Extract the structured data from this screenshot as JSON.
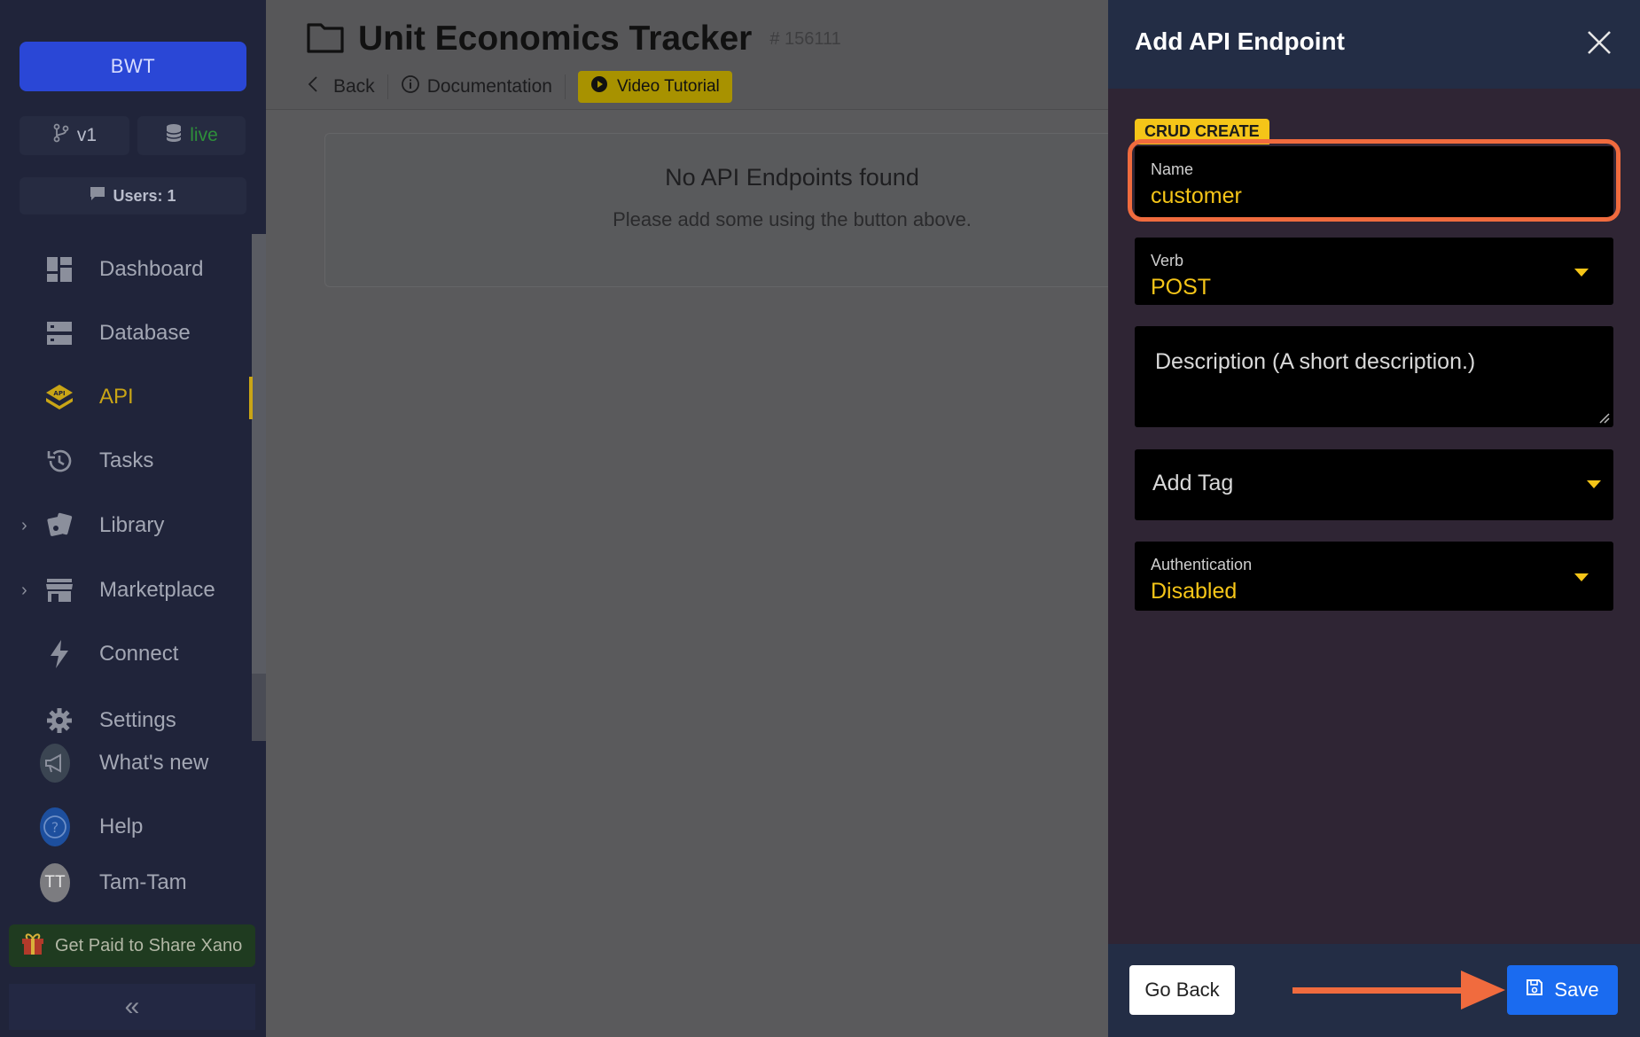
{
  "sidebar": {
    "workspace": "BWT",
    "branch": "v1",
    "datasource": "live",
    "users": "Users: 1",
    "items": [
      {
        "label": "Dashboard"
      },
      {
        "label": "Database"
      },
      {
        "label": "API"
      },
      {
        "label": "Tasks"
      },
      {
        "label": "Library"
      },
      {
        "label": "Marketplace"
      },
      {
        "label": "Connect"
      },
      {
        "label": "Settings"
      },
      {
        "label": "What's new"
      },
      {
        "label": "Help"
      }
    ],
    "user": {
      "initials": "TT",
      "name": "Tam-Tam"
    },
    "promo": "Get Paid to Share Xano",
    "collapse_icon": "«"
  },
  "page": {
    "title": "Unit Economics Tracker",
    "id": "# 156111",
    "back": "Back",
    "documentation": "Documentation",
    "video": "Video Tutorial",
    "empty_title": "No API Endpoints found",
    "empty_sub": "Please add some using the button above."
  },
  "panel": {
    "title": "Add API Endpoint",
    "badge": "CRUD CREATE",
    "name_label": "Name",
    "name_value": "customer",
    "verb_label": "Verb",
    "verb_value": "POST",
    "description_placeholder": "Description (A short description.)",
    "tag_placeholder": "Add Tag",
    "auth_label": "Authentication",
    "auth_value": "Disabled",
    "go_back": "Go Back",
    "save": "Save"
  },
  "colors": {
    "accent_yellow": "#f5c518",
    "save_blue": "#1a6bf0",
    "highlight": "#f06b3e",
    "panel_bg": "#2f2534",
    "panel_header": "#232d45"
  }
}
